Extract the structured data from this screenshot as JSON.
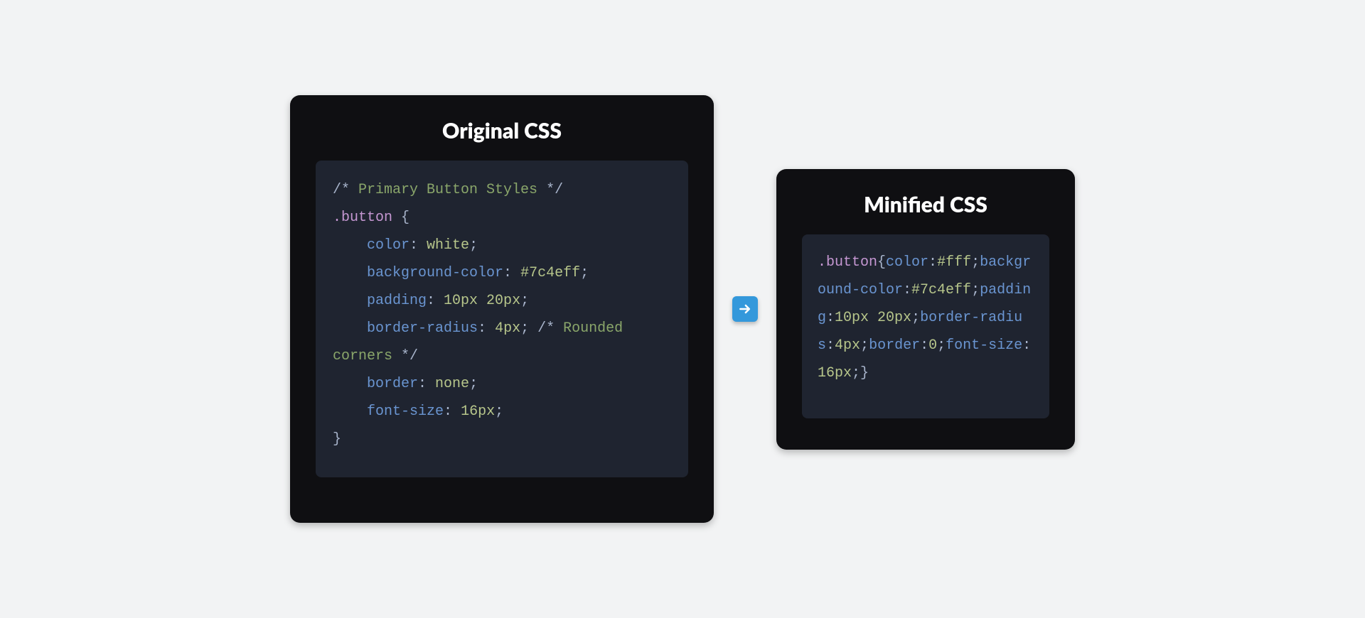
{
  "left": {
    "title": "Original CSS",
    "code": {
      "comment_open": "/* ",
      "comment1_text": "Primary Button Styles",
      "comment_close": " */",
      "selector": ".button",
      "brace_open": " {",
      "indent": "    ",
      "props": {
        "color": {
          "name": "color",
          "value": "white"
        },
        "bg": {
          "name": "background-color",
          "value": "#7c4eff"
        },
        "pad": {
          "name": "padding",
          "value": "10px 20px"
        },
        "radius": {
          "name": "border-radius",
          "value": "4px"
        },
        "border": {
          "name": "border",
          "value": "none"
        },
        "font": {
          "name": "font-size",
          "value": "16px"
        }
      },
      "radius_comment_text": "Rounded corners",
      "semicolon": ";",
      "colon_sp": ": ",
      "brace_close": "}"
    }
  },
  "right": {
    "title": "Minified CSS",
    "code": {
      "selector": ".button",
      "brace_open": "{",
      "props": {
        "color": {
          "name": "color",
          "value": "#fff"
        },
        "bg": {
          "name": "background-color",
          "value": "#7c4eff"
        },
        "pad": {
          "name": "padding",
          "value": "10px 20px"
        },
        "radius": {
          "name": "border-radius",
          "value": "4px"
        },
        "border": {
          "name": "border",
          "value": "0"
        },
        "font": {
          "name": "font-size",
          "value": "16px"
        }
      },
      "colon": ":",
      "semicolon": ";",
      "brace_close": "}"
    }
  }
}
